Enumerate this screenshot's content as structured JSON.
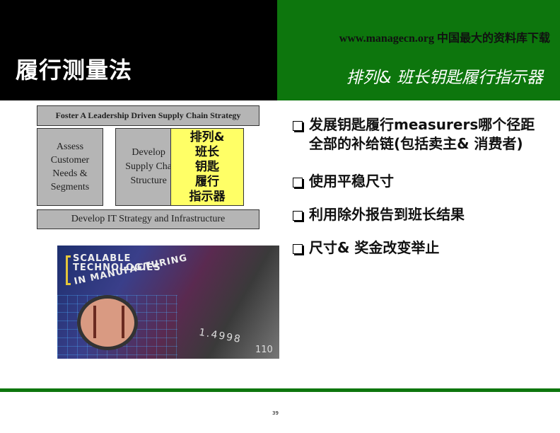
{
  "header": {
    "title": "履行测量法",
    "site": "www.managecn.org  中国最大的资料库下载",
    "subtitle": "排列& 班长钥匙履行指示器"
  },
  "diagram": {
    "top_box": "Foster A Leadership Driven Supply Chain Strategy",
    "assess_lines": [
      "Assess",
      "Customer",
      "Needs &",
      "Segments"
    ],
    "develop_lines": [
      "Develop",
      "Supply Cha",
      "Structure"
    ],
    "yellow_lines": [
      "排列&",
      "班长",
      "钥匙",
      "履行",
      "指示器"
    ],
    "bottom_box": "Develop IT Strategy and Infrastructure"
  },
  "bullets": [
    "发展钥匙履行measurers哪个径距全部的补给链(包括卖主& 消费者)",
    "使用平稳尺寸",
    "利用除外报告到班长结果",
    "尺寸& 奖金改变举止"
  ],
  "photo": {
    "line1": "SCALABLE",
    "line2": "TECHNOLOGIES",
    "line3": "IN MANUFACTURING",
    "gauge_number": "1.4998",
    "gauge_number2": "110"
  },
  "footer": {
    "page_number": "39"
  },
  "colors": {
    "green": "#0d760d",
    "yellow": "#ffff66",
    "gray_box": "#b5b5b5"
  }
}
